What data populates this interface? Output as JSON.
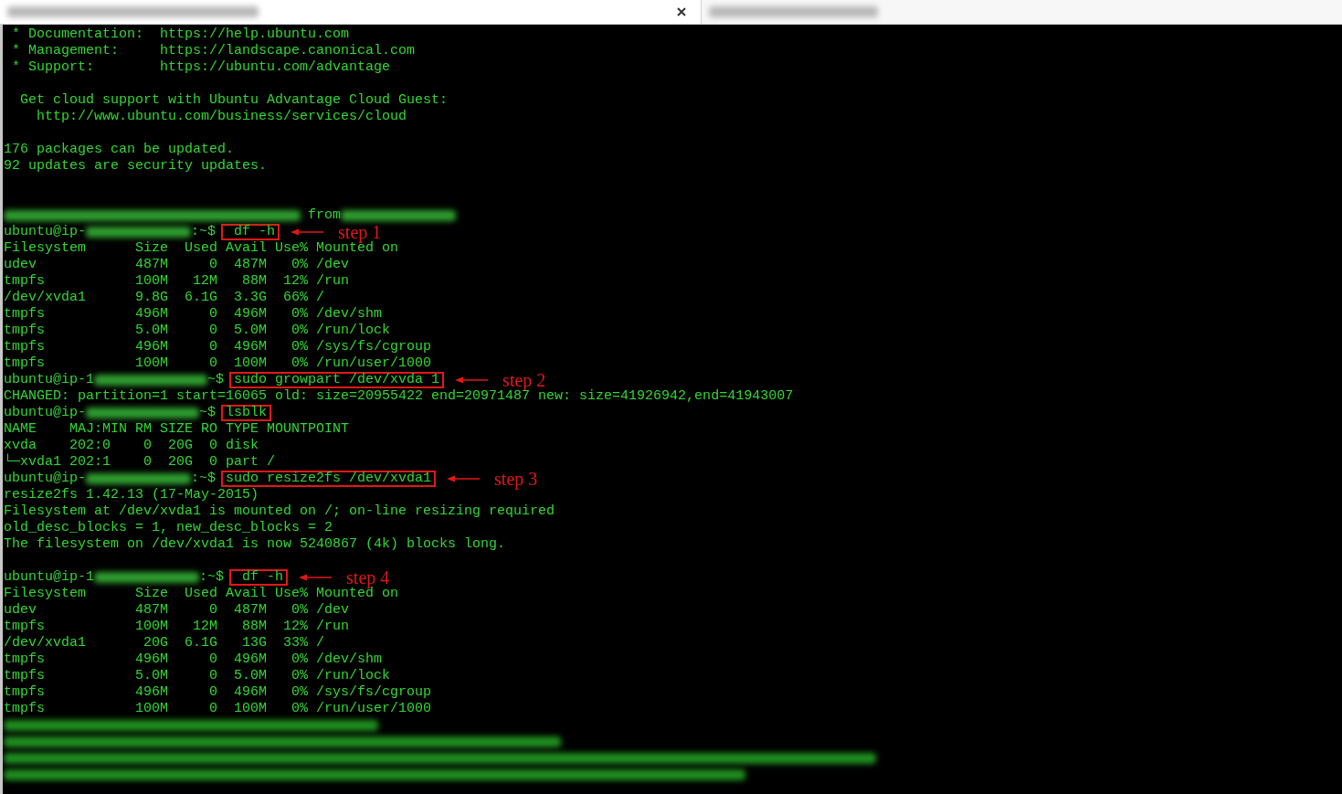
{
  "tabs": [
    {
      "selected": true,
      "closable": true
    },
    {
      "selected": false,
      "closable": false
    }
  ],
  "terminal": {
    "lines": [
      {
        "kind": "text",
        "text": " * Documentation:  https://help.ubuntu.com"
      },
      {
        "kind": "text",
        "text": " * Management:     https://landscape.canonical.com"
      },
      {
        "kind": "text",
        "text": " * Support:        https://ubuntu.com/advantage"
      },
      {
        "kind": "blank"
      },
      {
        "kind": "text",
        "text": "  Get cloud support with Ubuntu Advantage Cloud Guest:"
      },
      {
        "kind": "text",
        "text": "    http://www.ubuntu.com/business/services/cloud"
      },
      {
        "kind": "blank"
      },
      {
        "kind": "text",
        "text": "176 packages can be updated."
      },
      {
        "kind": "text",
        "text": "92 updates are security updates."
      },
      {
        "kind": "blank"
      },
      {
        "kind": "blank"
      },
      {
        "kind": "last_login",
        "text": "from"
      },
      {
        "kind": "prompt",
        "user": "ubuntu@ip-",
        "prompt_end": ":~$",
        "command": " df -h",
        "step": "step 1"
      },
      {
        "kind": "text",
        "text": "Filesystem      Size  Used Avail Use% Mounted on"
      },
      {
        "kind": "text",
        "text": "udev            487M     0  487M   0% /dev"
      },
      {
        "kind": "text",
        "text": "tmpfs           100M   12M   88M  12% /run"
      },
      {
        "kind": "text",
        "text": "/dev/xvda1      9.8G  6.1G  3.3G  66% /"
      },
      {
        "kind": "text",
        "text": "tmpfs           496M     0  496M   0% /dev/shm"
      },
      {
        "kind": "text",
        "text": "tmpfs           5.0M     0  5.0M   0% /run/lock"
      },
      {
        "kind": "text",
        "text": "tmpfs           496M     0  496M   0% /sys/fs/cgroup"
      },
      {
        "kind": "text",
        "text": "tmpfs           100M     0  100M   0% /run/user/1000"
      },
      {
        "kind": "prompt",
        "user": "ubuntu@ip-1",
        "prompt_end": "~$",
        "command": "sudo growpart /dev/xvda 1",
        "step": "step 2"
      },
      {
        "kind": "text",
        "text": "CHANGED: partition=1 start=16065 old: size=20955422 end=20971487 new: size=41926942,end=41943007"
      },
      {
        "kind": "prompt",
        "user": "ubuntu@ip-",
        "prompt_end": "~$",
        "command": "lsblk"
      },
      {
        "kind": "text",
        "text": "NAME    MAJ:MIN RM SIZE RO TYPE MOUNTPOINT"
      },
      {
        "kind": "text",
        "text": "xvda    202:0    0  20G  0 disk"
      },
      {
        "kind": "text",
        "text": "└─xvda1 202:1    0  20G  0 part /"
      },
      {
        "kind": "prompt",
        "user": "ubuntu@ip-",
        "prompt_end": ":~$",
        "command": "sudo resize2fs /dev/xvda1",
        "step": "step 3"
      },
      {
        "kind": "text",
        "text": "resize2fs 1.42.13 (17-May-2015)"
      },
      {
        "kind": "text",
        "text": "Filesystem at /dev/xvda1 is mounted on /; on-line resizing required"
      },
      {
        "kind": "text",
        "text": "old_desc_blocks = 1, new_desc_blocks = 2"
      },
      {
        "kind": "text",
        "text": "The filesystem on /dev/xvda1 is now 5240867 (4k) blocks long."
      },
      {
        "kind": "blank"
      },
      {
        "kind": "prompt",
        "user": "ubuntu@ip-1",
        "prompt_end": ":~$",
        "command": " df -h",
        "step": "step 4"
      },
      {
        "kind": "text",
        "text": "Filesystem      Size  Used Avail Use% Mounted on"
      },
      {
        "kind": "text",
        "text": "udev            487M     0  487M   0% /dev"
      },
      {
        "kind": "text",
        "text": "tmpfs           100M   12M   88M  12% /run"
      },
      {
        "kind": "text",
        "text": "/dev/xvda1       20G  6.1G   13G  33% /"
      },
      {
        "kind": "text",
        "text": "tmpfs           496M     0  496M   0% /dev/shm"
      },
      {
        "kind": "text",
        "text": "tmpfs           5.0M     0  5.0M   0% /run/lock"
      },
      {
        "kind": "text",
        "text": "tmpfs           496M     0  496M   0% /sys/fs/cgroup"
      },
      {
        "kind": "text",
        "text": "tmpfs           100M     0  100M   0% /run/user/1000"
      },
      {
        "kind": "blurred"
      },
      {
        "kind": "blurred"
      },
      {
        "kind": "blurred"
      },
      {
        "kind": "blurred"
      }
    ]
  }
}
